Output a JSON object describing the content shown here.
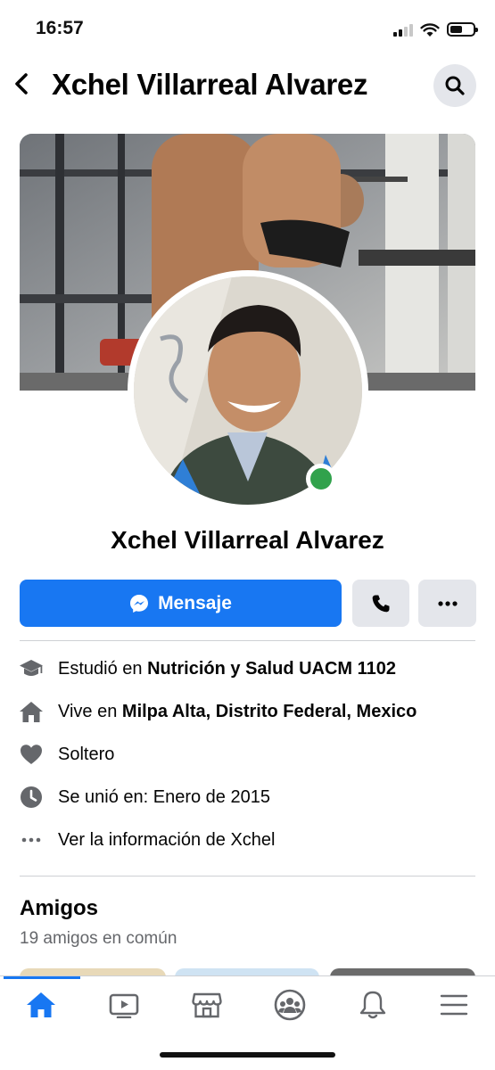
{
  "status_bar": {
    "time": "16:57"
  },
  "header": {
    "title": "Xchel Villarreal Alvarez"
  },
  "profile": {
    "name": "Xchel Villarreal Alvarez",
    "online": true
  },
  "actions": {
    "message_label": "Mensaje"
  },
  "details": {
    "education": {
      "prefix": "Estudió en ",
      "value": "Nutrición y Salud UACM 1102",
      "icon": "graduation-cap-icon"
    },
    "lives": {
      "prefix": "Vive en ",
      "value": "Milpa Alta, Distrito Federal, Mexico",
      "icon": "home-icon"
    },
    "relationship": {
      "text": "Soltero",
      "icon": "heart-icon"
    },
    "joined": {
      "text": "Se unió en: Enero de 2015",
      "icon": "clock-icon"
    },
    "see_more": {
      "text": "Ver la información de Xchel",
      "icon": "ellipsis-icon"
    }
  },
  "friends": {
    "title": "Amigos",
    "subtitle": "19 amigos en común"
  },
  "bottom_nav": {
    "items": [
      "home-icon",
      "video-icon",
      "marketplace-icon",
      "groups-icon",
      "bell-icon",
      "menu-icon"
    ],
    "active": "home-icon"
  },
  "colors": {
    "accent": "#1877f2",
    "online": "#31a24c",
    "button_gray": "#e4e6eb",
    "secondary_text": "#65676b"
  }
}
